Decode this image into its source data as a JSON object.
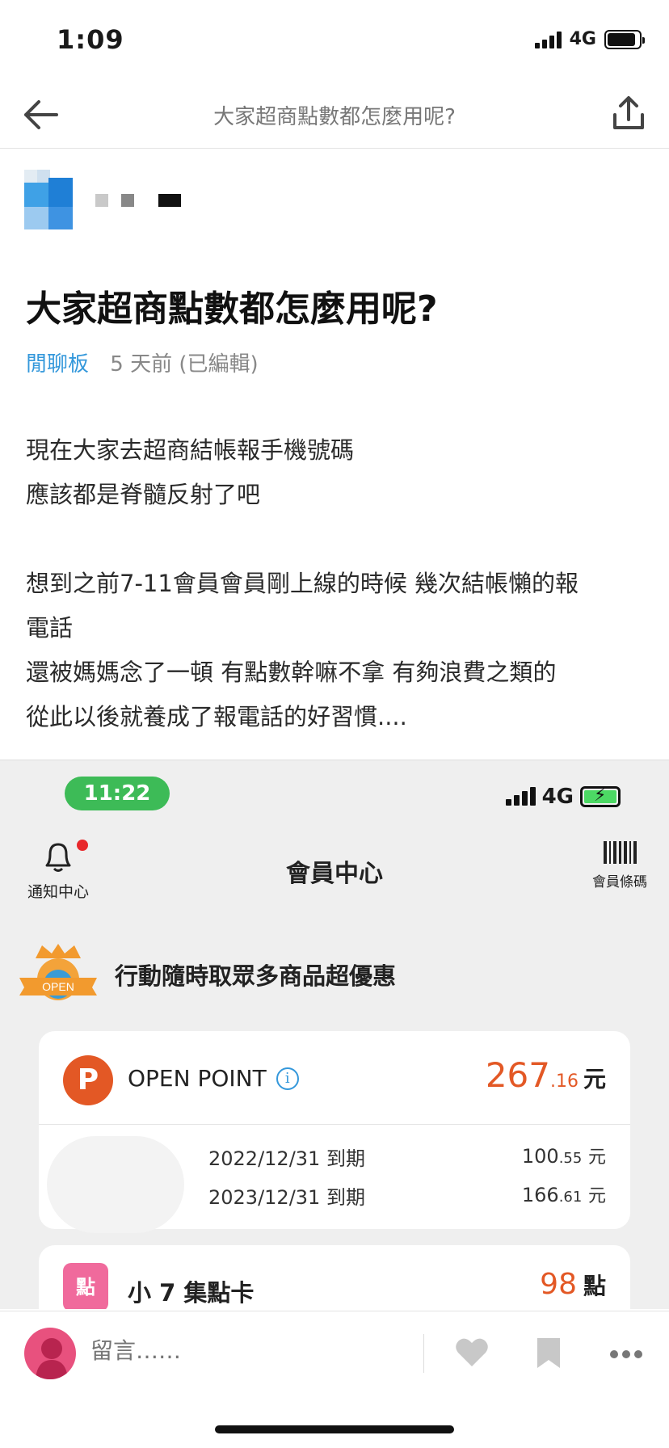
{
  "status_bar": {
    "time": "1:09",
    "network": "4G"
  },
  "nav": {
    "title": "大家超商點數都怎麼用呢?"
  },
  "post": {
    "title": "大家超商點數都怎麼用呢?",
    "board": "閒聊板",
    "meta": "5 天前 (已編輯)",
    "paragraphs": [
      "現在大家去超商結帳報手機號碼",
      "應該都是脊髓反射了吧",
      "",
      "想到之前7-11會員會員剛上線的時候 幾次結帳懶的報",
      "電話",
      "還被媽媽念了一頓 有點數幹嘛不拿 有夠浪費之類的",
      "從此以後就養成了報電話的好習慣...."
    ]
  },
  "screenshot": {
    "time": "11:22",
    "network": "4G",
    "bell_label": "通知中心",
    "title": "會員中心",
    "barcode_label": "會員條碼",
    "badge_label": "OPEN",
    "promo_text": "行動隨時取眾多商品超優惠",
    "points": {
      "logo": "P",
      "name": "OPEN POINT",
      "total_int": "267",
      "total_dec": ".16",
      "unit": "元",
      "rows": [
        {
          "date": "2022/12/31 到期",
          "int": "100",
          "dec": ".55",
          "unit": "元"
        },
        {
          "date": "2023/12/31 到期",
          "int": "166",
          "dec": ".61",
          "unit": "元"
        }
      ]
    },
    "stamp": {
      "icon_label": "點",
      "name": "小 7 集點卡",
      "value": "98",
      "unit": "點"
    }
  },
  "bottom": {
    "comment_placeholder": "留言……"
  },
  "colors": {
    "accent_blue": "#3498db",
    "points_orange": "#e35825",
    "green": "#3dbb57",
    "pink": "#e8517e"
  }
}
